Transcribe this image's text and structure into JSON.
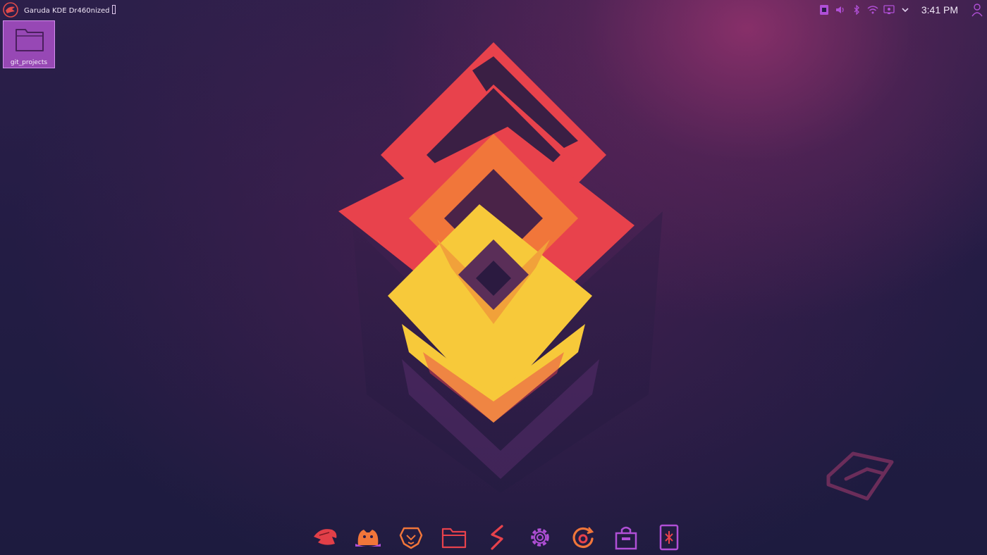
{
  "top_panel": {
    "window_title": "Garuda KDE Dr460nized",
    "clock": "3:41 PM"
  },
  "desktop": {
    "items": [
      {
        "label": "git_projects",
        "icon": "folder-icon"
      }
    ]
  },
  "tray_icons": [
    "clipboard-icon",
    "volume-icon",
    "bluetooth-icon",
    "wifi-icon",
    "display-config-icon",
    "chevron-down-icon"
  ],
  "dock": {
    "apps": [
      {
        "icon": "garuda-welcome-icon"
      },
      {
        "icon": "firefox-icon"
      },
      {
        "icon": "brave-icon"
      },
      {
        "icon": "file-manager-icon"
      },
      {
        "icon": "system-monitor-icon"
      },
      {
        "icon": "settings-gear-icon"
      },
      {
        "icon": "update-icon"
      },
      {
        "icon": "software-store-icon"
      },
      {
        "icon": "kde-connect-icon"
      }
    ]
  },
  "colors": {
    "accent_purple": "#b04fd6",
    "accent_red": "#e8424c",
    "accent_orange": "#f1763a",
    "accent_yellow": "#f7c93a"
  }
}
